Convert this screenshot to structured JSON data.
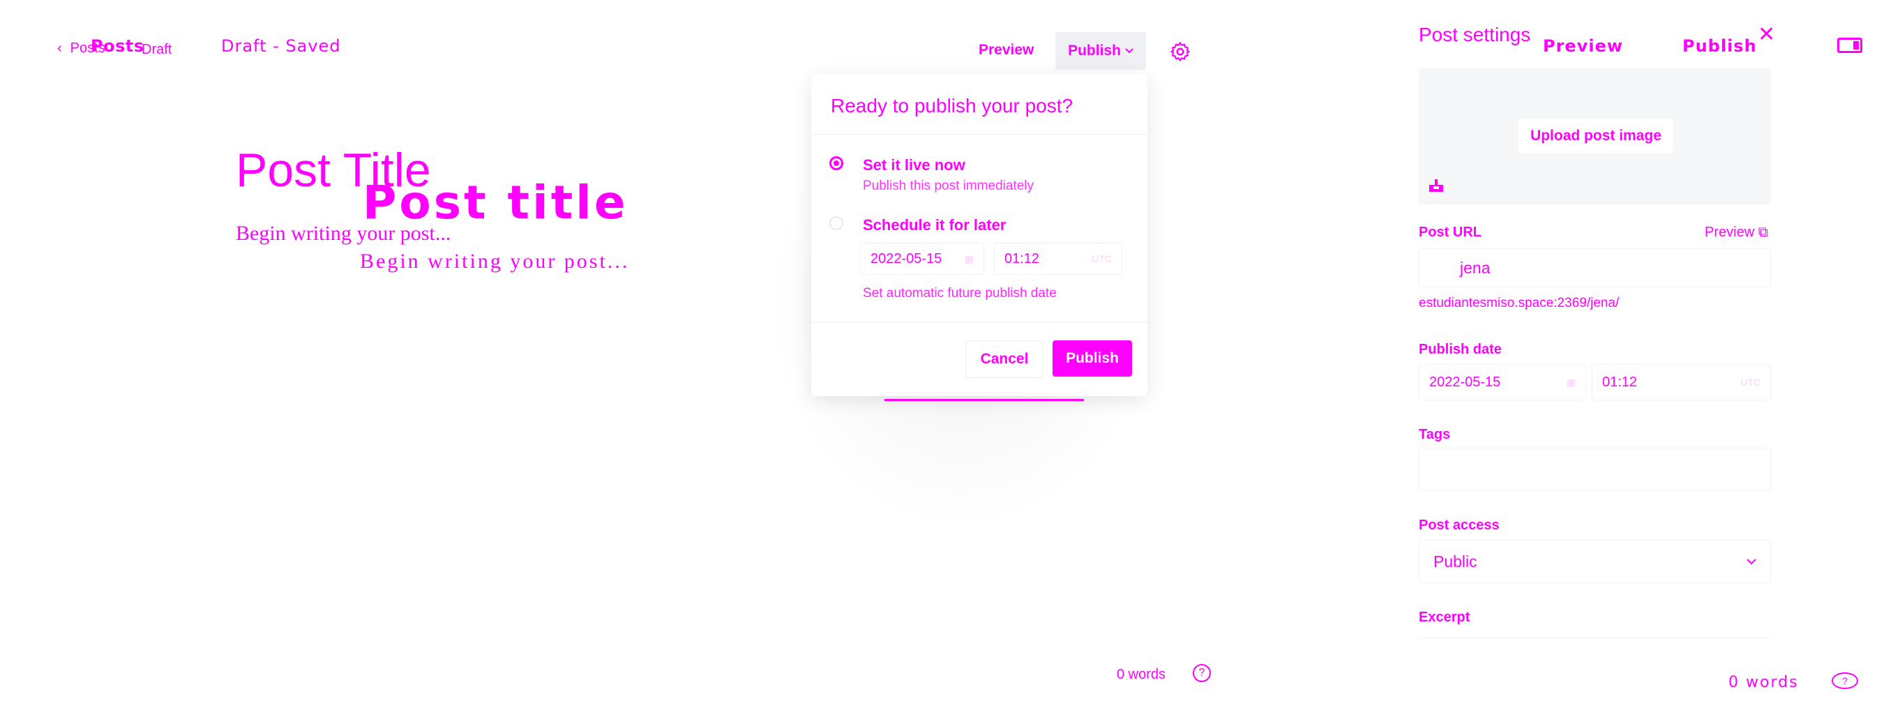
{
  "colors": {
    "accent": "#ff00ff",
    "button_bg": "#eef0f3",
    "image_box_bg": "#f6f7f8"
  },
  "topbar": {
    "posts_small": "Posts",
    "posts_bold": "Posts",
    "draft_small": "Draft",
    "draft_saved": "Draft - Saved",
    "preview_label": "Preview",
    "publish_label": "Publish"
  },
  "editor": {
    "title_placeholder": "Post Title",
    "title_placeholder_alt": "Post title",
    "body_placeholder": "Begin writing your post...",
    "body_placeholder_alt": "Begin writing your post..."
  },
  "publish_modal": {
    "title": "Ready to publish your post?",
    "option_live": "Set it live now",
    "option_live_desc": "Publish this post immediately",
    "option_schedule": "Schedule it for later",
    "date": "2022-05-15",
    "time": "01:12",
    "tz": "UTC",
    "hint": "Set automatic future publish date",
    "cancel_label": "Cancel",
    "publish_label": "Publish"
  },
  "footer": {
    "word_count": "0 words",
    "help_icon": "question-circle-icon"
  },
  "settings": {
    "title": "Post settings",
    "preview_label": "Preview",
    "publish_label": "Publish",
    "upload_label": "Upload post image",
    "url_label": "Post URL",
    "url_preview": "Preview",
    "slug": "jena",
    "url_full": "estudiantesmiso.space:2369/jena/",
    "date_label": "Publish date",
    "date": "2022-05-15",
    "time": "01:12",
    "tz": "UTC",
    "tags_label": "Tags",
    "access_label": "Post access",
    "access_value": "Public",
    "excerpt_label": "Excerpt",
    "word_count": "0 words"
  }
}
